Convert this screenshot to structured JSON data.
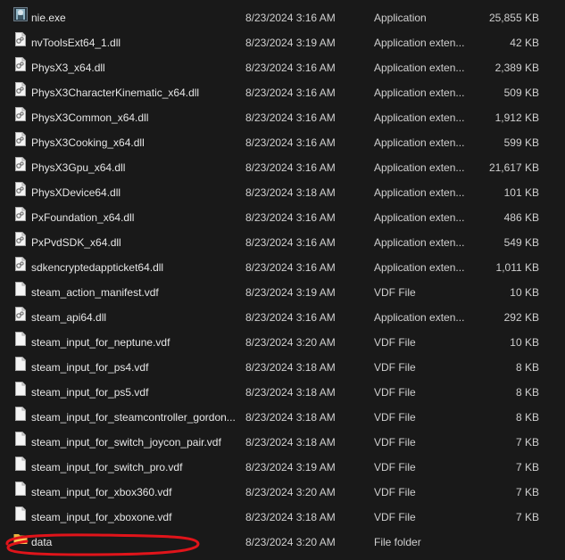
{
  "files": [
    {
      "name": "nie.exe",
      "date": "8/23/2024 3:16 AM",
      "type": "Application",
      "size": "25,855 KB",
      "icon": "app-icon"
    },
    {
      "name": "nvToolsExt64_1.dll",
      "date": "8/23/2024 3:19 AM",
      "type": "Application exten...",
      "size": "42 KB",
      "icon": "dll-icon"
    },
    {
      "name": "PhysX3_x64.dll",
      "date": "8/23/2024 3:16 AM",
      "type": "Application exten...",
      "size": "2,389 KB",
      "icon": "dll-icon"
    },
    {
      "name": "PhysX3CharacterKinematic_x64.dll",
      "date": "8/23/2024 3:16 AM",
      "type": "Application exten...",
      "size": "509 KB",
      "icon": "dll-icon"
    },
    {
      "name": "PhysX3Common_x64.dll",
      "date": "8/23/2024 3:16 AM",
      "type": "Application exten...",
      "size": "1,912 KB",
      "icon": "dll-icon"
    },
    {
      "name": "PhysX3Cooking_x64.dll",
      "date": "8/23/2024 3:16 AM",
      "type": "Application exten...",
      "size": "599 KB",
      "icon": "dll-icon"
    },
    {
      "name": "PhysX3Gpu_x64.dll",
      "date": "8/23/2024 3:16 AM",
      "type": "Application exten...",
      "size": "21,617 KB",
      "icon": "dll-icon"
    },
    {
      "name": "PhysXDevice64.dll",
      "date": "8/23/2024 3:18 AM",
      "type": "Application exten...",
      "size": "101 KB",
      "icon": "dll-icon"
    },
    {
      "name": "PxFoundation_x64.dll",
      "date": "8/23/2024 3:16 AM",
      "type": "Application exten...",
      "size": "486 KB",
      "icon": "dll-icon"
    },
    {
      "name": "PxPvdSDK_x64.dll",
      "date": "8/23/2024 3:16 AM",
      "type": "Application exten...",
      "size": "549 KB",
      "icon": "dll-icon"
    },
    {
      "name": "sdkencryptedappticket64.dll",
      "date": "8/23/2024 3:16 AM",
      "type": "Application exten...",
      "size": "1,011 KB",
      "icon": "dll-icon"
    },
    {
      "name": "steam_action_manifest.vdf",
      "date": "8/23/2024 3:19 AM",
      "type": "VDF File",
      "size": "10 KB",
      "icon": "file-icon"
    },
    {
      "name": "steam_api64.dll",
      "date": "8/23/2024 3:16 AM",
      "type": "Application exten...",
      "size": "292 KB",
      "icon": "dll-icon"
    },
    {
      "name": "steam_input_for_neptune.vdf",
      "date": "8/23/2024 3:20 AM",
      "type": "VDF File",
      "size": "10 KB",
      "icon": "file-icon"
    },
    {
      "name": "steam_input_for_ps4.vdf",
      "date": "8/23/2024 3:18 AM",
      "type": "VDF File",
      "size": "8 KB",
      "icon": "file-icon"
    },
    {
      "name": "steam_input_for_ps5.vdf",
      "date": "8/23/2024 3:18 AM",
      "type": "VDF File",
      "size": "8 KB",
      "icon": "file-icon"
    },
    {
      "name": "steam_input_for_steamcontroller_gordon...",
      "date": "8/23/2024 3:18 AM",
      "type": "VDF File",
      "size": "8 KB",
      "icon": "file-icon"
    },
    {
      "name": "steam_input_for_switch_joycon_pair.vdf",
      "date": "8/23/2024 3:18 AM",
      "type": "VDF File",
      "size": "7 KB",
      "icon": "file-icon"
    },
    {
      "name": "steam_input_for_switch_pro.vdf",
      "date": "8/23/2024 3:19 AM",
      "type": "VDF File",
      "size": "7 KB",
      "icon": "file-icon"
    },
    {
      "name": "steam_input_for_xbox360.vdf",
      "date": "8/23/2024 3:20 AM",
      "type": "VDF File",
      "size": "7 KB",
      "icon": "file-icon"
    },
    {
      "name": "steam_input_for_xboxone.vdf",
      "date": "8/23/2024 3:18 AM",
      "type": "VDF File",
      "size": "7 KB",
      "icon": "file-icon"
    },
    {
      "name": "data",
      "date": "8/23/2024 3:20 AM",
      "type": "File folder",
      "size": "",
      "icon": "folder-icon"
    }
  ],
  "annotation": {
    "target": "data",
    "color": "#e0141a"
  }
}
